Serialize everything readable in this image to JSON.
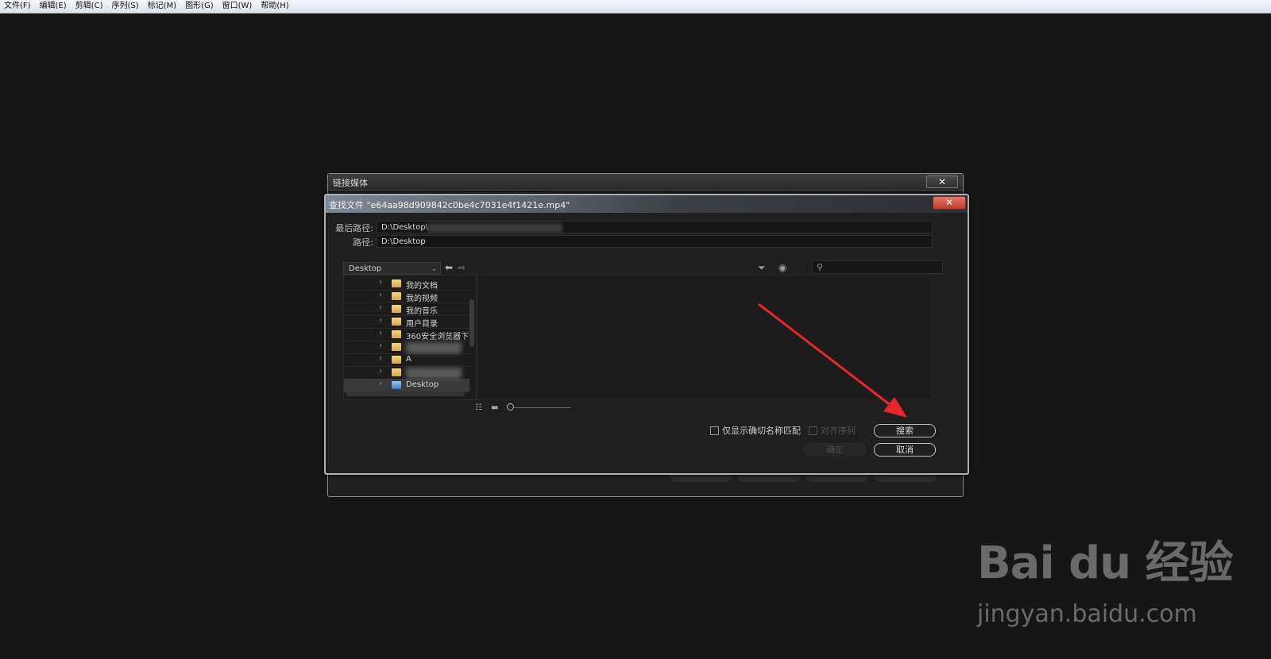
{
  "menu": [
    "文件(F)",
    "编辑(E)",
    "剪辑(C)",
    "序列(S)",
    "标记(M)",
    "图形(G)",
    "窗口(W)",
    "帮助(H)"
  ],
  "back_dialog": {
    "title": "链接媒体",
    "close": "✕"
  },
  "find_dialog": {
    "title": "查找文件 \"e64aa98d909842c0be4c7031e4f1421e.mp4\"",
    "close": "✕",
    "last_path_label": "最后路径:",
    "last_path_value": "D:\\Desktop\\",
    "path_label": "路径:",
    "path_value": "D:\\Desktop",
    "location_combo": "Desktop",
    "search_placeholder": "",
    "tree": [
      {
        "name": "我的文档",
        "icon": "folder-icon"
      },
      {
        "name": "我的视频",
        "icon": "folder-icon"
      },
      {
        "name": "我的音乐",
        "icon": "folder-icon"
      },
      {
        "name": "用户目录",
        "icon": "folder-icon"
      },
      {
        "name": "360安全浏览器下",
        "icon": "folder-icon"
      },
      {
        "name": "",
        "icon": "folder-icon"
      },
      {
        "name": "A",
        "icon": "folder-icon"
      },
      {
        "name": "",
        "icon": "folder-icon"
      },
      {
        "name": "Desktop",
        "icon": "desktop-icon"
      }
    ],
    "only_exact_name": "仅显示确切名称匹配",
    "align_sequence": "对齐序列",
    "search_button": "搜索",
    "ok_button": "确定",
    "cancel_button": "取消"
  },
  "watermark": {
    "logo": "Bai du 经验",
    "url": "jingyan.baidu.com"
  },
  "colors": {
    "annotation_arrow": "#e8262a",
    "close_red": "#c4392a"
  }
}
